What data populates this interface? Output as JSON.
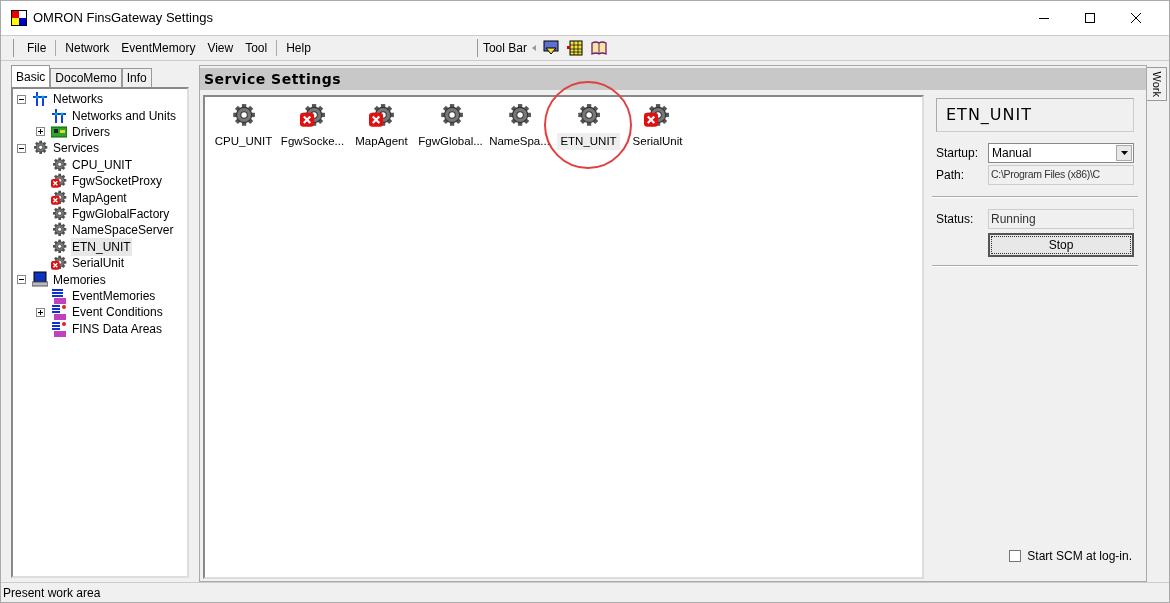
{
  "window": {
    "title": "OMRON FinsGateway Settings"
  },
  "menu": [
    {
      "label": "File"
    },
    {
      "label": "Network"
    },
    {
      "label": "EventMemory"
    },
    {
      "label": "View"
    },
    {
      "label": "Tool"
    },
    {
      "label": "Help"
    }
  ],
  "toolbar": {
    "label": "Tool Bar",
    "buttons": [
      {
        "kind": "monitor"
      },
      {
        "kind": "grid"
      },
      {
        "kind": "book"
      }
    ]
  },
  "left_tabs": [
    {
      "label": "Basic",
      "selected": true
    },
    {
      "label": "DocoMemo",
      "selected": false
    },
    {
      "label": "Info",
      "selected": false
    }
  ],
  "tree": [
    {
      "label": "Networks",
      "kind": "network",
      "expanded": true,
      "selected": false,
      "children": [
        {
          "label": "Networks and Units",
          "kind": "network",
          "selected": false
        },
        {
          "label": "Drivers",
          "kind": "drivers",
          "expanded": false,
          "selected": false
        }
      ]
    },
    {
      "label": "Services",
      "kind": "gear",
      "expanded": true,
      "selected": false,
      "children": [
        {
          "label": "CPU_UNIT",
          "kind": "gear",
          "selected": false
        },
        {
          "label": "FgwSocketProxy",
          "kind": "error",
          "selected": false
        },
        {
          "label": "MapAgent",
          "kind": "error",
          "selected": false
        },
        {
          "label": "FgwGlobalFactory",
          "kind": "gear",
          "selected": false
        },
        {
          "label": "NameSpaceServer",
          "kind": "gear",
          "selected": false
        },
        {
          "label": "ETN_UNIT",
          "kind": "gear",
          "selected": true
        },
        {
          "label": "SerialUnit",
          "kind": "error",
          "selected": false
        }
      ]
    },
    {
      "label": "Memories",
      "kind": "memory",
      "expanded": true,
      "selected": false,
      "children": [
        {
          "label": "EventMemories",
          "kind": "events",
          "selected": false
        },
        {
          "label": "Event Conditions",
          "kind": "conditions",
          "expanded": false,
          "selected": false
        },
        {
          "label": "FINS Data Areas",
          "kind": "conditions",
          "selected": false
        }
      ]
    }
  ],
  "panel": {
    "title": "Service Settings",
    "services": [
      {
        "label": "CPU_UNIT",
        "error": false,
        "selected": false,
        "circled": false
      },
      {
        "label": "FgwSocke...",
        "error": true,
        "selected": false,
        "circled": false
      },
      {
        "label": "MapAgent",
        "error": true,
        "selected": false,
        "circled": false
      },
      {
        "label": "FgwGlobal...",
        "error": false,
        "selected": false,
        "circled": false
      },
      {
        "label": "NameSpa...",
        "error": false,
        "selected": false,
        "circled": false
      },
      {
        "label": "ETN_UNIT",
        "error": false,
        "selected": true,
        "circled": true
      },
      {
        "label": "SerialUnit",
        "error": true,
        "selected": false,
        "circled": false
      }
    ]
  },
  "details": {
    "name": "ETN_UNIT",
    "startup_label": "Startup:",
    "startup": "Manual",
    "path_label": "Path:",
    "path": "C:\\Program Files (x86)\\C",
    "status_label": "Status:",
    "status": "Running",
    "stop_button": "Stop",
    "scm_label": "Start SCM at log-in.",
    "scm_checked": false
  },
  "side_tab": {
    "label": "Work"
  },
  "status_bar": "Present work area"
}
